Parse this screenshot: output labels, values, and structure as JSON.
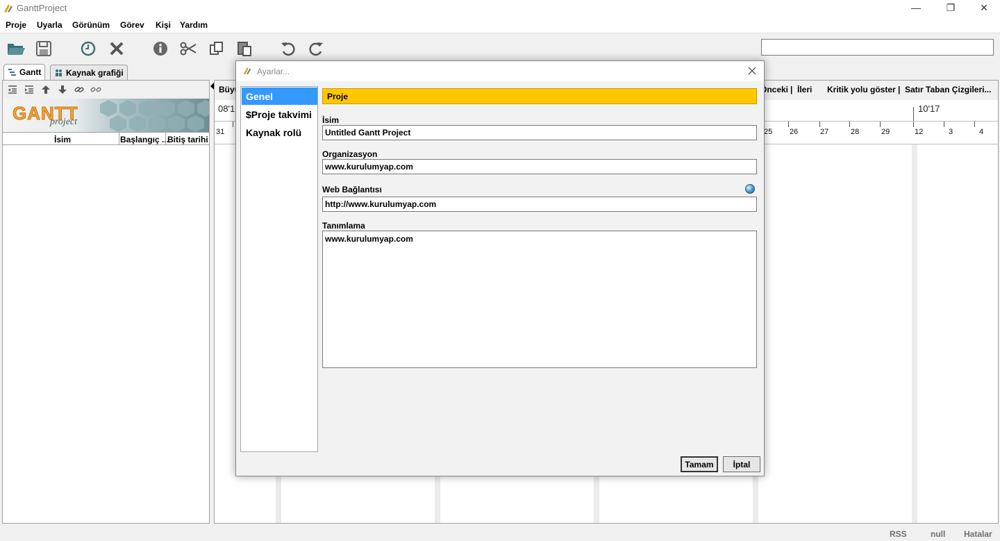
{
  "window": {
    "title": "GanttProject",
    "controls": [
      "—",
      "❐",
      "✕"
    ]
  },
  "menu": [
    "Proje",
    "Uyarla",
    "Görünüm",
    "Görev",
    "Kişi",
    "Yardım"
  ],
  "toolbar": {
    "icons": [
      "open-folder-icon",
      "save-icon",
      "history-clock-icon",
      "delete-icon",
      "info-icon",
      "cut-icon",
      "copy-icon",
      "paste-icon",
      "undo-icon",
      "redo-icon"
    ],
    "search_value": ""
  },
  "tabs": [
    {
      "label": "Gantt",
      "active": true
    },
    {
      "label": "Kaynak grafiği",
      "active": false
    }
  ],
  "left_panel": {
    "logo_text": "GANTT",
    "logo_sub": "project",
    "columns": [
      "İsim",
      "Başlangıç ...",
      "Bitiş tarihi"
    ]
  },
  "gantt_toolbar": {
    "left_cut": "Büyü",
    "prev": "Önceki",
    "next": "İleri",
    "sep": "|",
    "critical": "Kritik yolu göster",
    "baseline": "Satır Taban Çizgileri..."
  },
  "timeline": {
    "month_left": "08'1",
    "month_right": "10'17",
    "day_first": "31",
    "days": [
      "25",
      "26",
      "27",
      "28",
      "29",
      "12",
      "3",
      "4"
    ]
  },
  "status": {
    "rss": "RSS",
    "null": "null",
    "errors": "Hatalar"
  },
  "dialog": {
    "title": "Ayarlar...",
    "nav": [
      "Genel",
      "$Proje takvimi",
      "Kaynak rolü"
    ],
    "section": "Proje",
    "fields": {
      "name_label": "İsim",
      "name_value": "Untitled Gantt Project",
      "org_label": "Organizasyon",
      "org_value": "www.kurulumyap.com",
      "web_label": "Web Bağlantısı",
      "web_value": "http://www.kurulumyap.com",
      "desc_label": "Tanımlama",
      "desc_value": "www.kurulumyap.com"
    },
    "ok": "Tamam",
    "cancel": "İptal"
  },
  "colors": {
    "accent": "#3399ff",
    "section_header": "#ffc700"
  }
}
